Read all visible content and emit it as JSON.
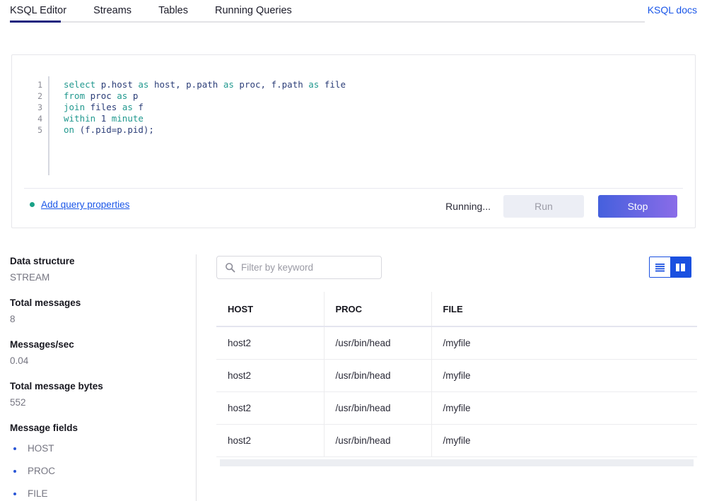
{
  "nav": {
    "tabs": [
      {
        "label": "KSQL Editor",
        "active": true
      },
      {
        "label": "Streams",
        "active": false
      },
      {
        "label": "Tables",
        "active": false
      },
      {
        "label": "Running Queries",
        "active": false
      }
    ],
    "docs_link": "KSQL docs"
  },
  "editor": {
    "lines": [
      {
        "number": "1",
        "tokens": [
          {
            "t": "select",
            "c": "kw"
          },
          {
            "t": " ",
            "c": "pun"
          },
          {
            "t": "p.host",
            "c": "id"
          },
          {
            "t": " ",
            "c": "pun"
          },
          {
            "t": "as",
            "c": "kw"
          },
          {
            "t": " ",
            "c": "pun"
          },
          {
            "t": "host,",
            "c": "id"
          },
          {
            "t": " ",
            "c": "pun"
          },
          {
            "t": "p.path",
            "c": "id"
          },
          {
            "t": " ",
            "c": "pun"
          },
          {
            "t": "as",
            "c": "kw"
          },
          {
            "t": " ",
            "c": "pun"
          },
          {
            "t": "proc,",
            "c": "id"
          },
          {
            "t": " ",
            "c": "pun"
          },
          {
            "t": "f.path",
            "c": "id"
          },
          {
            "t": " ",
            "c": "pun"
          },
          {
            "t": "as",
            "c": "kw"
          },
          {
            "t": " ",
            "c": "pun"
          },
          {
            "t": "file",
            "c": "id"
          }
        ]
      },
      {
        "number": "2",
        "tokens": [
          {
            "t": "from",
            "c": "kw"
          },
          {
            "t": " ",
            "c": "pun"
          },
          {
            "t": "proc",
            "c": "id"
          },
          {
            "t": " ",
            "c": "pun"
          },
          {
            "t": "as",
            "c": "kw"
          },
          {
            "t": " ",
            "c": "pun"
          },
          {
            "t": "p",
            "c": "id"
          }
        ]
      },
      {
        "number": "3",
        "tokens": [
          {
            "t": "join",
            "c": "kw"
          },
          {
            "t": " ",
            "c": "pun"
          },
          {
            "t": "files",
            "c": "id"
          },
          {
            "t": " ",
            "c": "pun"
          },
          {
            "t": "as",
            "c": "kw"
          },
          {
            "t": " ",
            "c": "pun"
          },
          {
            "t": "f",
            "c": "id"
          }
        ]
      },
      {
        "number": "4",
        "tokens": [
          {
            "t": "within",
            "c": "kw"
          },
          {
            "t": " ",
            "c": "pun"
          },
          {
            "t": "1",
            "c": "num"
          },
          {
            "t": " ",
            "c": "pun"
          },
          {
            "t": "minute",
            "c": "kw"
          }
        ]
      },
      {
        "number": "5",
        "tokens": [
          {
            "t": "on",
            "c": "kw"
          },
          {
            "t": " ",
            "c": "pun"
          },
          {
            "t": "(f.pid=p.pid);",
            "c": "id"
          }
        ]
      }
    ],
    "full_query": "select p.host as host, p.path as proc, f.path as file\nfrom proc as p\njoin files as f\nwithin 1 minute\non (f.pid=p.pid);",
    "add_query_properties": "Add query properties",
    "status_label": "Running...",
    "run_label": "Run",
    "stop_label": "Stop"
  },
  "sidebar": {
    "stats": [
      {
        "label": "Data structure",
        "value": "STREAM"
      },
      {
        "label": "Total messages",
        "value": "8"
      },
      {
        "label": "Messages/sec",
        "value": "0.04"
      },
      {
        "label": "Total message bytes",
        "value": "552"
      }
    ],
    "fields_title": "Message fields",
    "fields": [
      "HOST",
      "PROC",
      "FILE"
    ]
  },
  "results": {
    "search_placeholder": "Filter by keyword",
    "search_value": "",
    "view_modes": [
      {
        "name": "list-view",
        "active": false
      },
      {
        "name": "table-view",
        "active": true
      }
    ],
    "columns": [
      "HOST",
      "PROC",
      "FILE"
    ],
    "rows": [
      [
        "host2",
        "/usr/bin/head",
        "/myfile"
      ],
      [
        "host2",
        "/usr/bin/head",
        "/myfile"
      ],
      [
        "host2",
        "/usr/bin/head",
        "/myfile"
      ],
      [
        "host2",
        "/usr/bin/head",
        "/myfile"
      ]
    ]
  },
  "colors": {
    "accent_blue": "#1a50e0",
    "link_blue": "#1a56e8",
    "active_tab_underline": "#1a237e",
    "keyword_teal": "#22998f",
    "identifier_navy": "#2c3e78",
    "stop_gradient_start": "#4560dd",
    "stop_gradient_end": "#8a6ce8",
    "bullet_teal": "#19a187"
  }
}
